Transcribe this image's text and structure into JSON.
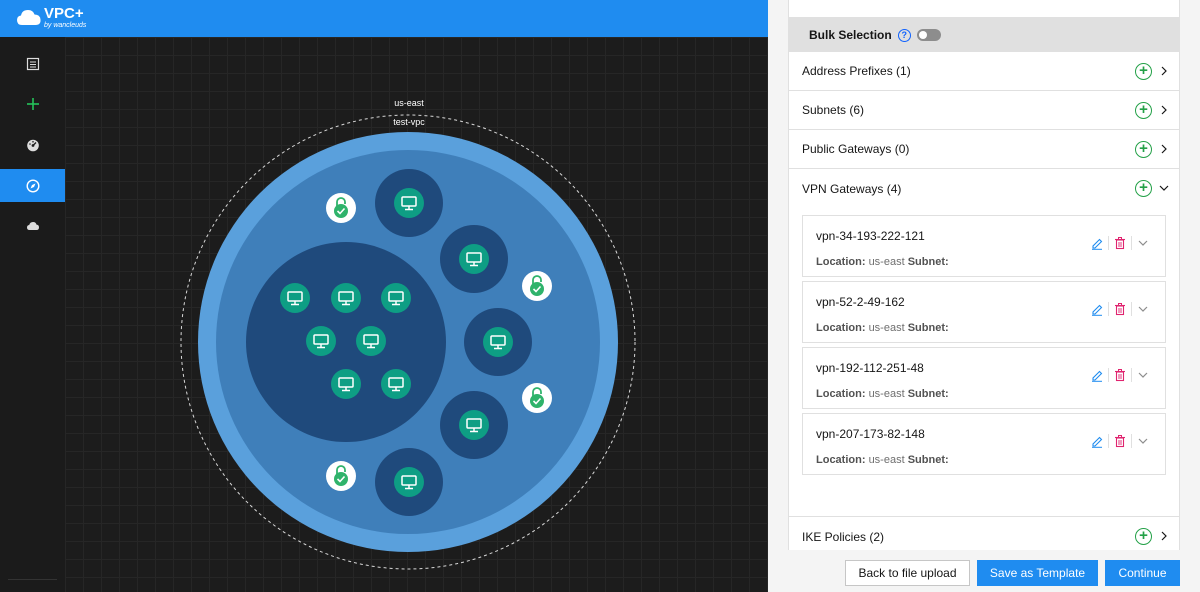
{
  "app": {
    "brand": "VPC+",
    "sub": "by wancleuds"
  },
  "sidebar": {
    "items": [
      {
        "icon": "list-icon"
      },
      {
        "icon": "plus-icon"
      },
      {
        "icon": "gauge-icon"
      },
      {
        "icon": "compass-icon",
        "active": true
      },
      {
        "icon": "cloud-icon"
      }
    ]
  },
  "diagram": {
    "zone_label": "us-east",
    "vpc_label": "test-vpc"
  },
  "panel": {
    "bulk_selection_label": "Bulk Selection",
    "help_glyph": "?",
    "sections": [
      {
        "label": "Address Prefixes (1)"
      },
      {
        "label": "Subnets (6)"
      },
      {
        "label": "Public Gateways (0)"
      },
      {
        "label": "VPN Gateways (4)"
      },
      {
        "label": "IKE Policies (2)"
      }
    ],
    "vpn_gateways": [
      {
        "name": "vpn-34-193-222-121",
        "location_label": "Location:",
        "location": "us-east",
        "subnet_label": "Subnet:"
      },
      {
        "name": "vpn-52-2-49-162",
        "location_label": "Location:",
        "location": "us-east",
        "subnet_label": "Subnet:"
      },
      {
        "name": "vpn-192-112-251-48",
        "location_label": "Location:",
        "location": "us-east",
        "subnet_label": "Subnet:"
      },
      {
        "name": "vpn-207-173-82-148",
        "location_label": "Location:",
        "location": "us-east",
        "subnet_label": "Subnet:"
      }
    ]
  },
  "footer": {
    "back_label": "Back to file upload",
    "save_template_label": "Save as Template",
    "continue_label": "Continue"
  },
  "colors": {
    "accent": "#1f8cf0",
    "add_green": "#24a148",
    "vsi_green": "#0e9e84",
    "ring_outer": "#5aa0dc",
    "ring_inner": "#3f7fba",
    "subnet_dark": "#1f4a7c"
  }
}
